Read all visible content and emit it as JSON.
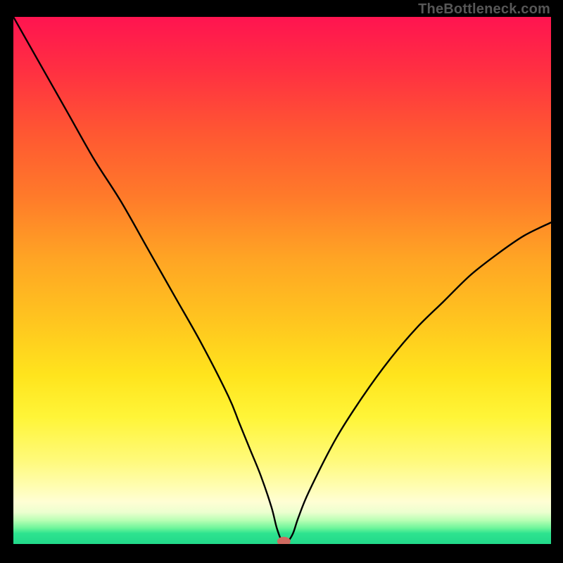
{
  "watermark": "TheBottleneck.com",
  "chart_data": {
    "type": "line",
    "title": "",
    "xlabel": "",
    "ylabel": "",
    "x": [
      0,
      5,
      10,
      15,
      20,
      25,
      30,
      35,
      40,
      42,
      44,
      46,
      48,
      49,
      50,
      51,
      52,
      53,
      55,
      60,
      65,
      70,
      75,
      80,
      85,
      90,
      95,
      100
    ],
    "y": [
      100,
      91,
      82,
      73,
      65,
      56,
      47,
      38,
      28,
      23,
      18,
      13,
      7,
      3,
      0.5,
      0.5,
      2,
      5,
      10,
      20,
      28,
      35,
      41,
      46,
      51,
      55,
      58.5,
      61
    ],
    "xlim": [
      0,
      100
    ],
    "ylim": [
      0,
      100
    ],
    "valley_marker": {
      "x": 50.3,
      "y": 0.5
    },
    "background_gradient": [
      "#ff1450",
      "#ff5732",
      "#ffa524",
      "#ffe41d",
      "#fffed4",
      "#22d98a"
    ]
  }
}
